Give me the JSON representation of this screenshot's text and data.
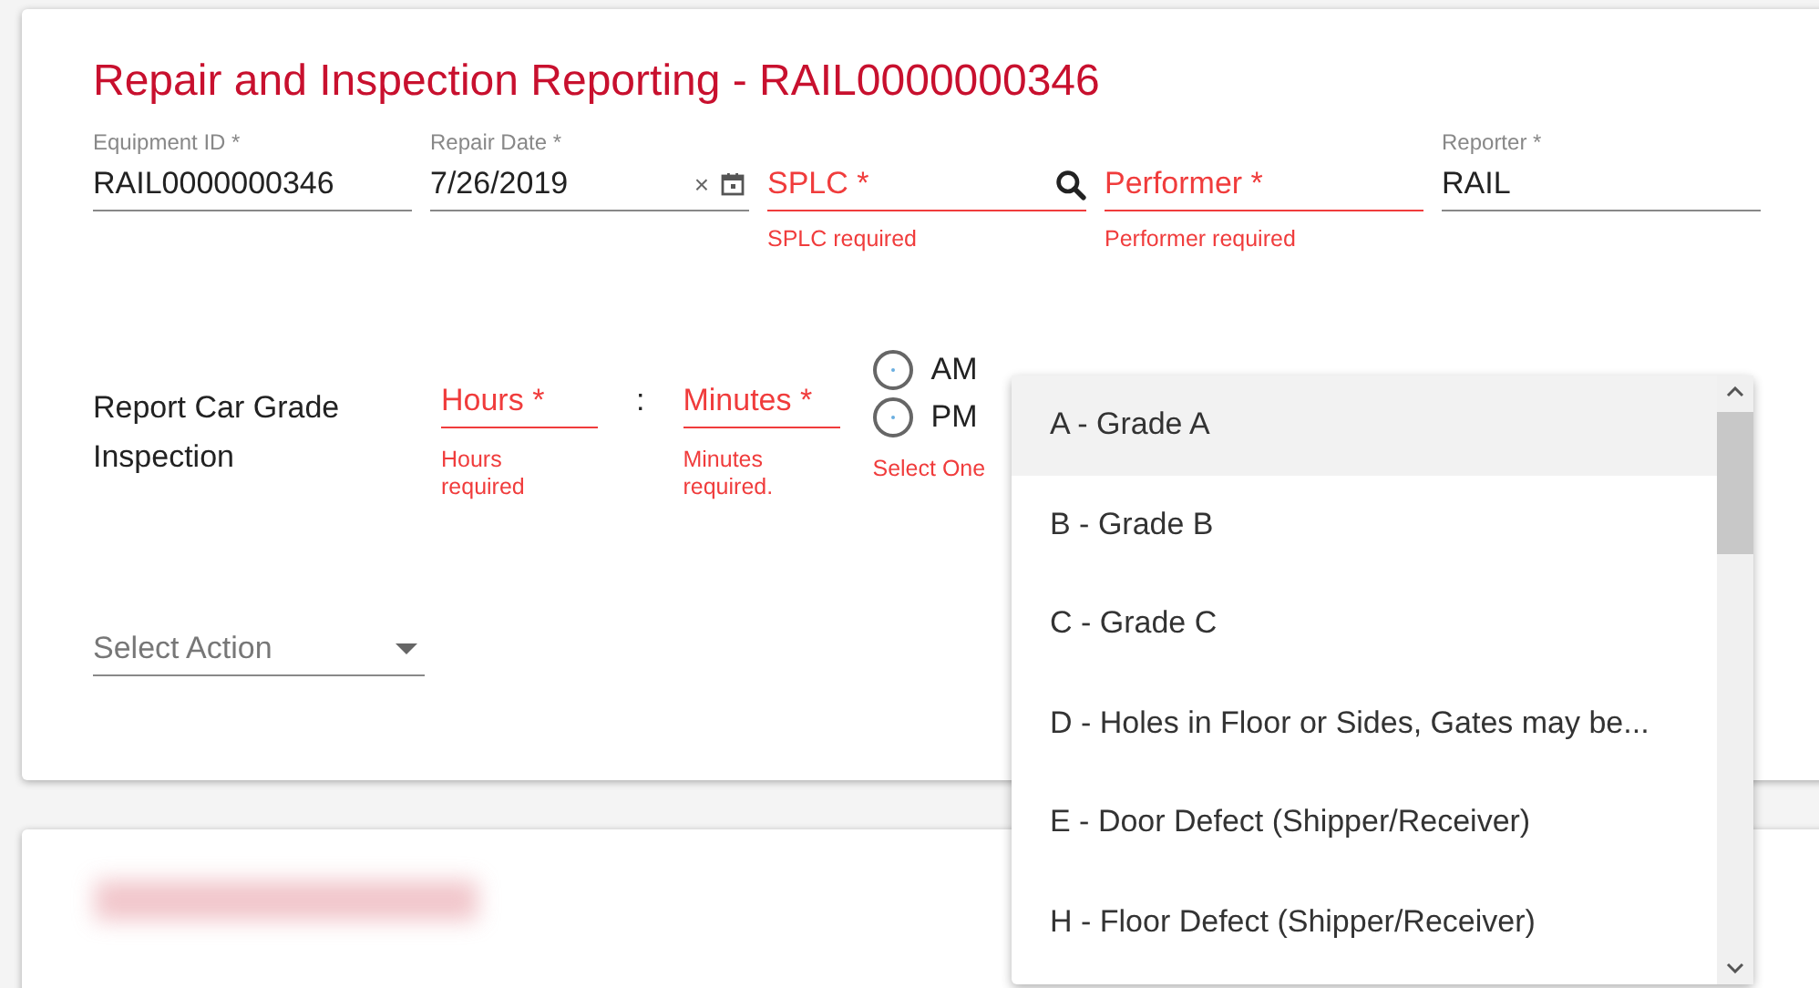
{
  "title": "Repair and Inspection Reporting - RAIL0000000346",
  "fields": [
    {
      "label": "Equipment ID *",
      "value": "RAIL0000000346",
      "error": false
    },
    {
      "label": "Repair Date *",
      "value": "7/26/2019",
      "error": false,
      "kind": "date",
      "clear": "×"
    },
    {
      "placeholder": "SPLC *",
      "error": true,
      "message": "SPLC required",
      "kind": "search"
    },
    {
      "placeholder": "Performer *",
      "error": true,
      "message": "Performer required"
    },
    {
      "label": "Reporter *",
      "value": "RAIL",
      "error": false
    }
  ],
  "inspection": {
    "label": "Report Car Grade Inspection",
    "hours": {
      "placeholder": "Hours *",
      "message": "Hours required"
    },
    "separator": ":",
    "minutes": {
      "placeholder": "Minutes *",
      "message": "Minutes required."
    },
    "meridiem": [
      {
        "label": "AM",
        "selected": false
      },
      {
        "label": "PM",
        "selected": false
      }
    ],
    "meridiem_message": "Select One"
  },
  "action": {
    "placeholder": "Select Action"
  },
  "dropdown": {
    "options": [
      {
        "label": "A - Grade A",
        "selected": true
      },
      {
        "label": "B - Grade B",
        "selected": false
      },
      {
        "label": "C - Grade C",
        "selected": false
      },
      {
        "label": "D - Holes in Floor or Sides, Gates may be...",
        "selected": false
      },
      {
        "label": "E - Door Defect (Shipper/Receiver)",
        "selected": false
      },
      {
        "label": "H - Floor Defect (Shipper/Receiver)",
        "selected": false
      }
    ]
  }
}
